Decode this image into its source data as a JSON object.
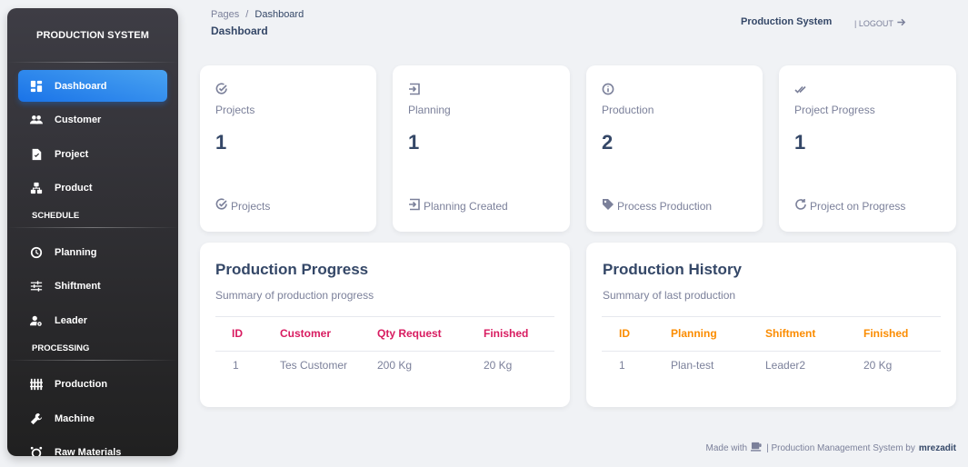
{
  "sidebar": {
    "brand": "PRODUCTION SYSTEM",
    "items": [
      {
        "label": "Dashboard",
        "icon": "dashboard-icon",
        "active": true
      },
      {
        "label": "Customer",
        "icon": "people-icon"
      },
      {
        "label": "Project",
        "icon": "document-icon"
      },
      {
        "label": "Product",
        "icon": "hierarchy-icon"
      }
    ],
    "section_schedule": "SCHEDULE",
    "schedule_items": [
      {
        "label": "Planning",
        "icon": "clock-icon"
      },
      {
        "label": "Shiftment",
        "icon": "sliders-icon"
      },
      {
        "label": "Leader",
        "icon": "person-gear-icon"
      }
    ],
    "section_processing": "PROCESSING",
    "processing_items": [
      {
        "label": "Production",
        "icon": "factory-icon"
      },
      {
        "label": "Machine",
        "icon": "wrench-icon"
      },
      {
        "label": "Raw Materials",
        "icon": "alarm-icon"
      }
    ]
  },
  "header": {
    "breadcrumb_root": "Pages",
    "breadcrumb_sep": "/",
    "breadcrumb_current": "Dashboard",
    "title": "Dashboard",
    "system_name": "Production System",
    "logout": "| LOGOUT"
  },
  "stats": [
    {
      "icon": "check-circle-icon",
      "label": "Projects",
      "value": "1",
      "footer_icon": "check-circle-icon",
      "footer": "Projects"
    },
    {
      "icon": "login-icon",
      "label": "Planning",
      "value": "1",
      "footer_icon": "login-icon",
      "footer": "Planning Created"
    },
    {
      "icon": "info-icon",
      "label": "Production",
      "value": "2",
      "footer_icon": "tag-icon",
      "footer": "Process Production"
    },
    {
      "icon": "double-check-icon",
      "label": "Project Progress",
      "value": "1",
      "footer_icon": "refresh-icon",
      "footer": "Project on Progress"
    }
  ],
  "progress_table": {
    "title": "Production Progress",
    "subtitle": "Summary of production progress",
    "columns": [
      "ID",
      "Customer",
      "Qty Request",
      "Finished"
    ],
    "rows": [
      [
        "1",
        "Tes Customer",
        "200 Kg",
        "20 Kg"
      ]
    ],
    "header_color": "#d81b60"
  },
  "history_table": {
    "title": "Production History",
    "subtitle": "Summary of last production",
    "columns": [
      "ID",
      "Planning",
      "Shiftment",
      "Finished"
    ],
    "rows": [
      [
        "1",
        "Plan-test",
        "Leader2",
        "20 Kg"
      ]
    ],
    "header_color": "#fb8c00"
  },
  "footer": {
    "made_with": "Made with",
    "icon": "coffee-icon",
    "text": "| Production Management System by",
    "author": "mrezadit"
  },
  "colors": {
    "accent": "#1a73e8",
    "sidebar_bg": "#202020",
    "text": "#344767",
    "muted": "#7b809a"
  }
}
